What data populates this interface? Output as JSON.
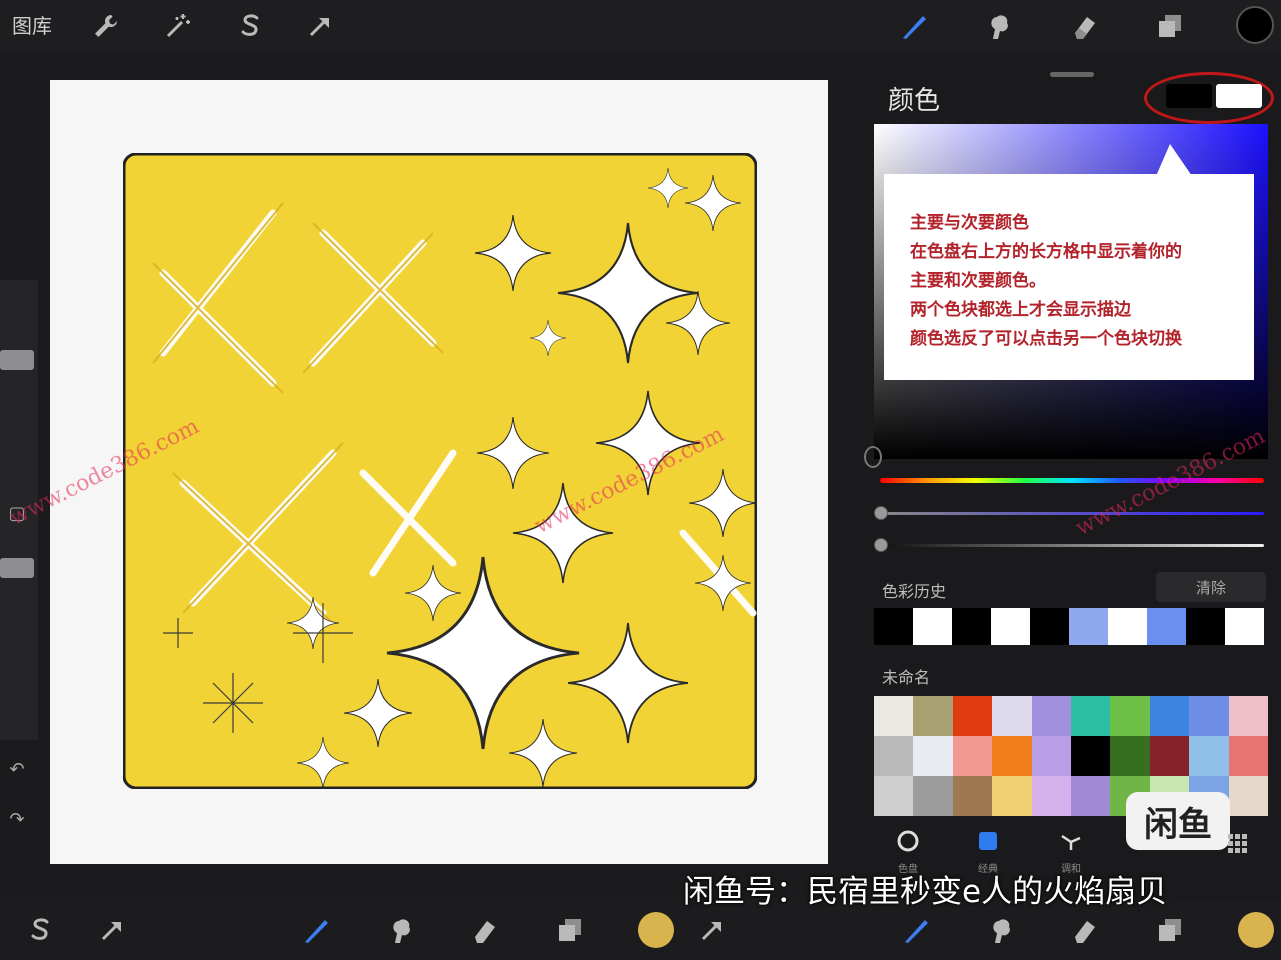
{
  "top_bar": {
    "gallery_label": "图库",
    "left_icons": [
      "wrench-icon",
      "magic-wand-icon",
      "selection-s-icon",
      "transform-arrow-icon"
    ],
    "right_icons": [
      "brush-icon",
      "smudge-icon",
      "eraser-icon",
      "layers-icon"
    ],
    "color_dot": "#000000"
  },
  "color_panel": {
    "title": "颜色",
    "primary_color": "#000000",
    "secondary_color": "#ffffff",
    "callout": {
      "lines": [
        "主要与次要颜色",
        "在色盘右上方的长方格中显示着你的",
        "主要和次要颜色。",
        "两个色块都选上才会显示描边",
        "颜色选反了可以点击另一个色块切换"
      ]
    },
    "history": {
      "label": "色彩历史",
      "clear_label": "清除",
      "swatches": [
        "#000000",
        "#ffffff",
        "#000000",
        "#ffffff",
        "#000000",
        "#8fa8f0",
        "#ffffff",
        "#6b8ff0",
        "#000000",
        "#ffffff"
      ]
    },
    "palette": {
      "label": "未命名",
      "swatches": [
        "#ece9e2",
        "#a8a070",
        "#e03a10",
        "#dcd9ec",
        "#a08fdc",
        "#2dbfa5",
        "#6ebf47",
        "#3d83e0",
        "#6e8ee6",
        "#f0c0c8",
        "#b9b9b9",
        "#e8ecf2",
        "#f29a92",
        "#f07f1b",
        "#b89fe6",
        "#000000",
        "#356f1f",
        "#85222a",
        "#8fc0ea",
        "#e87474",
        "#cfcfcf",
        "#9c9c9c",
        "#a07850",
        "#f0d070",
        "#d6b0ea",
        "#a08ad6",
        "#6fb548",
        "#c8e8b0",
        "#7aa4e6",
        "#e6d8c8"
      ]
    },
    "tabs": [
      {
        "label": "色盘",
        "icon": "disc-icon"
      },
      {
        "label": "经典",
        "icon": "square-icon"
      },
      {
        "label": "调和",
        "icon": "harmony-icon"
      }
    ]
  },
  "badge": {
    "text": "闲鱼"
  },
  "footer": {
    "caption": "闲鱼号：民宿里秒变e人的火焰扇贝"
  },
  "watermarks": [
    "www.code386.com",
    "www.code386.com",
    "www.code386.com"
  ]
}
